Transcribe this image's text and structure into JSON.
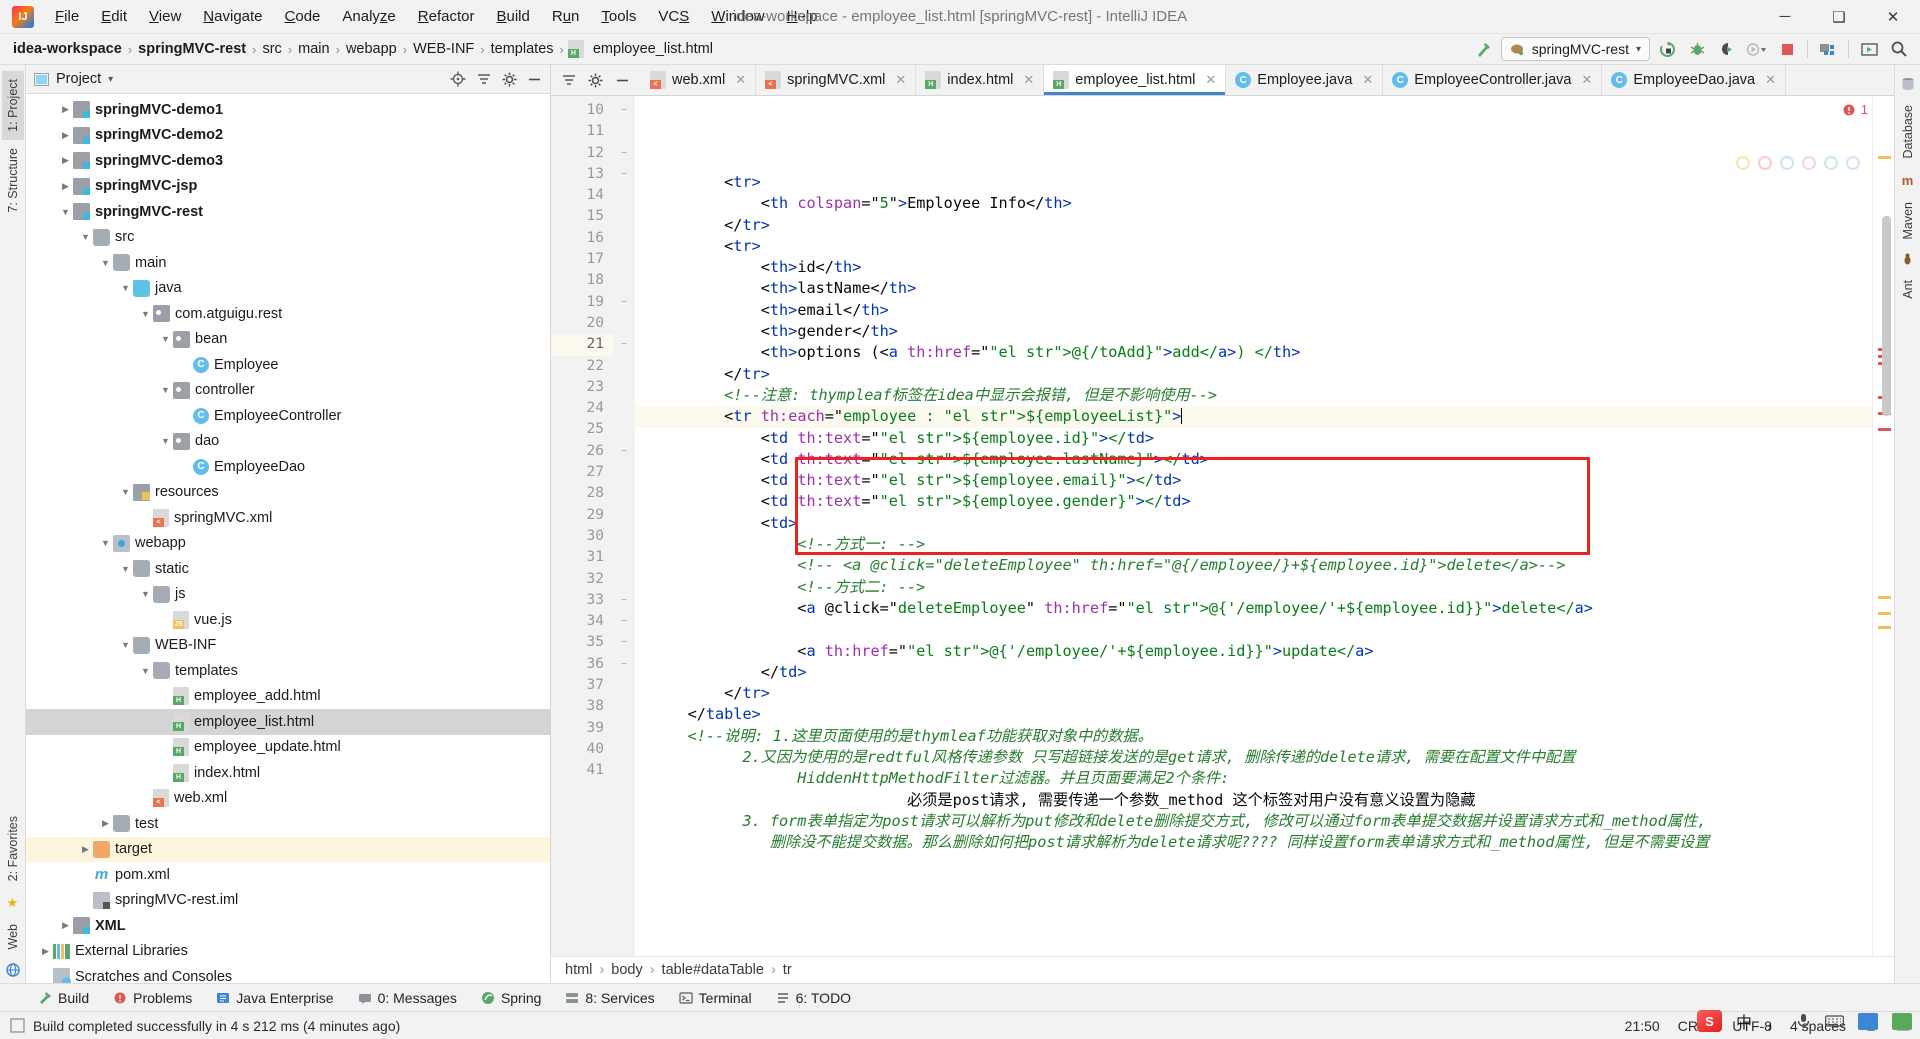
{
  "window": {
    "title": "idea-workspace - employee_list.html [springMVC-rest] - IntelliJ IDEA",
    "logo_text": "IJ",
    "minimize": "─",
    "maximize": "❑",
    "close": "✕"
  },
  "menubar": [
    {
      "label": "File"
    },
    {
      "label": "Edit"
    },
    {
      "label": "View"
    },
    {
      "label": "Navigate"
    },
    {
      "label": "Code"
    },
    {
      "label": "Analyze"
    },
    {
      "label": "Refactor"
    },
    {
      "label": "Build"
    },
    {
      "label": "Run"
    },
    {
      "label": "Tools"
    },
    {
      "label": "VCS"
    },
    {
      "label": "Window"
    },
    {
      "label": "Help"
    }
  ],
  "breadcrumb": {
    "items": [
      {
        "label": "idea-workspace",
        "bold": true
      },
      {
        "label": "springMVC-rest",
        "bold": true
      },
      {
        "label": "src",
        "bold": false
      },
      {
        "label": "main",
        "bold": false
      },
      {
        "label": "webapp",
        "bold": false
      },
      {
        "label": "WEB-INF",
        "bold": false
      },
      {
        "label": "templates",
        "bold": false
      },
      {
        "label": "employee_list.html",
        "bold": false
      }
    ],
    "separator": "›"
  },
  "toolbar": {
    "hammer_icon": "build-hammer-icon",
    "run_config": "springMVC-rest",
    "dropdown_caret": "▾",
    "icons": [
      {
        "name": "run-button"
      },
      {
        "name": "debug-button"
      },
      {
        "name": "run-with-coverage-button"
      },
      {
        "name": "profile-button"
      },
      {
        "name": "stop-button"
      },
      {
        "name": "project-structure-button"
      },
      {
        "name": "updates-button"
      },
      {
        "name": "search-everywhere-button"
      }
    ]
  },
  "left_strip": [
    {
      "label": "1: Project",
      "selected": true
    },
    {
      "label": "7: Structure",
      "selected": false
    },
    {
      "label": "2: Favorites",
      "selected": false
    },
    {
      "label": "Web",
      "selected": false
    }
  ],
  "right_strip": [
    {
      "label": "Database"
    },
    {
      "label": "Maven"
    },
    {
      "label": "Ant"
    }
  ],
  "project_panel": {
    "title": "Project",
    "title_caret": "▾",
    "locate_icon": "locate-icon",
    "collapse_icon": "collapse-all-icon",
    "settings_icon": "gear-icon",
    "hide_icon": "hide-icon",
    "tree": [
      {
        "label": "springMVC-demo1",
        "depth": 1,
        "arrow": "▶",
        "icon": "module",
        "bold": true
      },
      {
        "label": "springMVC-demo2",
        "depth": 1,
        "arrow": "▶",
        "icon": "module",
        "bold": true
      },
      {
        "label": "springMVC-demo3",
        "depth": 1,
        "arrow": "▶",
        "icon": "module",
        "bold": true
      },
      {
        "label": "springMVC-jsp",
        "depth": 1,
        "arrow": "▶",
        "icon": "module",
        "bold": true
      },
      {
        "label": "springMVC-rest",
        "depth": 1,
        "arrow": "▼",
        "icon": "module",
        "bold": true
      },
      {
        "label": "src",
        "depth": 2,
        "arrow": "▼",
        "icon": "folder",
        "bold": false
      },
      {
        "label": "main",
        "depth": 3,
        "arrow": "▼",
        "icon": "folder",
        "bold": false
      },
      {
        "label": "java",
        "depth": 4,
        "arrow": "▼",
        "icon": "folder-src",
        "bold": false
      },
      {
        "label": "com.atguigu.rest",
        "depth": 5,
        "arrow": "▼",
        "icon": "package",
        "bold": false
      },
      {
        "label": "bean",
        "depth": 6,
        "arrow": "▼",
        "icon": "package",
        "bold": false
      },
      {
        "label": "Employee",
        "depth": 7,
        "arrow": "",
        "icon": "class",
        "bold": false
      },
      {
        "label": "controller",
        "depth": 6,
        "arrow": "▼",
        "icon": "package",
        "bold": false
      },
      {
        "label": "EmployeeController",
        "depth": 7,
        "arrow": "",
        "icon": "class",
        "bold": false
      },
      {
        "label": "dao",
        "depth": 6,
        "arrow": "▼",
        "icon": "package",
        "bold": false
      },
      {
        "label": "EmployeeDao",
        "depth": 7,
        "arrow": "",
        "icon": "class",
        "bold": false
      },
      {
        "label": "resources",
        "depth": 4,
        "arrow": "▼",
        "icon": "resources",
        "bold": false
      },
      {
        "label": "springMVC.xml",
        "depth": 5,
        "arrow": "",
        "icon": "file-xml",
        "bold": false
      },
      {
        "label": "webapp",
        "depth": 3,
        "arrow": "▼",
        "icon": "webapp",
        "bold": false
      },
      {
        "label": "static",
        "depth": 4,
        "arrow": "▼",
        "icon": "folder",
        "bold": false
      },
      {
        "label": "js",
        "depth": 5,
        "arrow": "▼",
        "icon": "folder",
        "bold": false
      },
      {
        "label": "vue.js",
        "depth": 6,
        "arrow": "",
        "icon": "file-js",
        "bold": false
      },
      {
        "label": "WEB-INF",
        "depth": 4,
        "arrow": "▼",
        "icon": "folder",
        "bold": false
      },
      {
        "label": "templates",
        "depth": 5,
        "arrow": "▼",
        "icon": "folder",
        "bold": false
      },
      {
        "label": "employee_add.html",
        "depth": 6,
        "arrow": "",
        "icon": "file-html",
        "bold": false
      },
      {
        "label": "employee_list.html",
        "depth": 6,
        "arrow": "",
        "icon": "file-html",
        "bold": false,
        "selected": true
      },
      {
        "label": "employee_update.html",
        "depth": 6,
        "arrow": "",
        "icon": "file-html",
        "bold": false
      },
      {
        "label": "index.html",
        "depth": 6,
        "arrow": "",
        "icon": "file-html",
        "bold": false
      },
      {
        "label": "web.xml",
        "depth": 5,
        "arrow": "",
        "icon": "file-xml",
        "bold": false
      },
      {
        "label": "test",
        "depth": 3,
        "arrow": "▶",
        "icon": "folder",
        "bold": false
      },
      {
        "label": "target",
        "depth": 2,
        "arrow": "▶",
        "icon": "folder-orange",
        "bold": false,
        "highlight": true
      },
      {
        "label": "pom.xml",
        "depth": 2,
        "arrow": "",
        "icon": "maven",
        "bold": false
      },
      {
        "label": "springMVC-rest.iml",
        "depth": 2,
        "arrow": "",
        "icon": "iml",
        "bold": false
      },
      {
        "label": "XML",
        "depth": 1,
        "arrow": "▶",
        "icon": "module",
        "bold": true
      },
      {
        "label": "External Libraries",
        "depth": 0,
        "arrow": "▶",
        "icon": "library",
        "bold": false
      },
      {
        "label": "Scratches and Consoles",
        "depth": 0,
        "arrow": "",
        "icon": "scratches",
        "bold": false
      }
    ]
  },
  "editor_tabs": [
    {
      "label": "web.xml",
      "icon": "file-xml",
      "active": false,
      "close": "✕"
    },
    {
      "label": "springMVC.xml",
      "icon": "file-xml-ok",
      "active": false,
      "close": "✕"
    },
    {
      "label": "index.html",
      "icon": "file-html",
      "active": false,
      "close": "✕"
    },
    {
      "label": "employee_list.html",
      "icon": "file-html",
      "active": true,
      "close": "✕"
    },
    {
      "label": "Employee.java",
      "icon": "class",
      "active": false,
      "close": "✕"
    },
    {
      "label": "EmployeeController.java",
      "icon": "class",
      "active": false,
      "close": "✕"
    },
    {
      "label": "EmployeeDao.java",
      "icon": "class",
      "active": false,
      "close": "✕"
    }
  ],
  "code": {
    "first_line_number": 10,
    "lines": [
      {
        "n": 10,
        "fold": "−",
        "current": false
      },
      {
        "n": 11,
        "fold": "",
        "current": false
      },
      {
        "n": 12,
        "fold": "−",
        "current": false
      },
      {
        "n": 13,
        "fold": "−",
        "current": false
      },
      {
        "n": 14,
        "fold": "",
        "current": false
      },
      {
        "n": 15,
        "fold": "",
        "current": false
      },
      {
        "n": 16,
        "fold": "",
        "current": false
      },
      {
        "n": 17,
        "fold": "",
        "current": false
      },
      {
        "n": 18,
        "fold": "",
        "current": false
      },
      {
        "n": 19,
        "fold": "−",
        "current": false
      },
      {
        "n": 20,
        "fold": "",
        "current": false
      },
      {
        "n": 21,
        "fold": "−",
        "current": true
      },
      {
        "n": 22,
        "fold": "",
        "current": false
      },
      {
        "n": 23,
        "fold": "",
        "current": false
      },
      {
        "n": 24,
        "fold": "",
        "current": false
      },
      {
        "n": 25,
        "fold": "",
        "current": false
      },
      {
        "n": 26,
        "fold": "−",
        "current": false
      },
      {
        "n": 27,
        "fold": "",
        "current": false
      },
      {
        "n": 28,
        "fold": "",
        "current": false
      },
      {
        "n": 29,
        "fold": "",
        "current": false
      },
      {
        "n": 30,
        "fold": "",
        "current": false
      },
      {
        "n": 31,
        "fold": "",
        "current": false
      },
      {
        "n": 32,
        "fold": "",
        "current": false
      },
      {
        "n": 33,
        "fold": "−",
        "current": false
      },
      {
        "n": 34,
        "fold": "−",
        "current": false
      },
      {
        "n": 35,
        "fold": "−",
        "current": false
      },
      {
        "n": 36,
        "fold": "−",
        "current": false
      },
      {
        "n": 37,
        "fold": "",
        "current": false
      },
      {
        "n": 38,
        "fold": "",
        "current": false
      },
      {
        "n": 39,
        "fold": "",
        "current": false
      },
      {
        "n": 40,
        "fold": "",
        "current": false
      },
      {
        "n": 41,
        "fold": "",
        "current": false
      }
    ],
    "text": [
      "        <tr>",
      "            <th colspan=\"5\">Employee Info</th>",
      "        </tr>",
      "        <tr>",
      "            <th>id</th>",
      "            <th>lastName</th>",
      "            <th>email</th>",
      "            <th>gender</th>",
      "            <th>options (<a th:href=\"@{/toAdd}\">add</a>) </th>",
      "        </tr>",
      "        <!--注意: thympleaf标签在idea中显示会报错, 但是不影响使用-->",
      "        <tr th:each=\"employee : ${employeeList}\">",
      "            <td th:text=\"${employee.id}\"></td>",
      "            <td th:text=\"${employee.lastName}\"></td>",
      "            <td th:text=\"${employee.email}\"></td>",
      "            <td th:text=\"${employee.gender}\"></td>",
      "            <td>",
      "                <!--方式一: -->",
      "                <!-- <a @click=\"deleteEmployee\" th:href=\"@{/employee/}+${employee.id}\">delete</a>-->",
      "                <!--方式二: -->",
      "                <a @click=\"deleteEmployee\" th:href=\"@{'/employee/'+${employee.id}}\">delete</a>",
      "",
      "                <a th:href=\"@{'/employee/'+${employee.id}}\">update</a>",
      "            </td>",
      "        </tr>",
      "    </table>",
      "    <!--说明: 1.这里页面使用的是thymleaf功能获取对象中的数据。",
      "          2.又因为使用的是redtful风格传递参数 只写超链接发送的是get请求, 删除传递的delete请求, 需要在配置文件中配置",
      "                HiddenHttpMethodFilter过滤器。并且页面要满足2个条件:",
      "                            必须是post请求, 需要传递一个参数_method 这个标签对用户没有意义设置为隐藏",
      "          3. form表单指定为post请求可以解析为put修改和delete删除提交方式, 修改可以通过form表单提交数据并设置请求方式和_method属性,",
      "             删除没不能提交数据。那么删除如何把post请求解析为delete请求呢???? 同样设置form表单请求方式和_method属性, 但是不需要设置"
    ]
  },
  "editor_breadcrumb": {
    "items": [
      "html",
      "body",
      "table#dataTable",
      "tr"
    ],
    "separator": "›"
  },
  "bottom_bar": [
    {
      "label": "Build",
      "icon": "build-icon",
      "shortcut": ""
    },
    {
      "label": "Problems",
      "icon": "problems-icon",
      "shortcut": ""
    },
    {
      "label": "Java Enterprise",
      "icon": "java-ee-icon",
      "shortcut": ""
    },
    {
      "label": "0: Messages",
      "icon": "messages-icon",
      "shortcut": "0"
    },
    {
      "label": "Spring",
      "icon": "spring-icon",
      "shortcut": ""
    },
    {
      "label": "8: Services",
      "icon": "services-icon",
      "shortcut": "8"
    },
    {
      "label": "Terminal",
      "icon": "terminal-icon",
      "shortcut": ""
    },
    {
      "label": "6: TODO",
      "icon": "todo-icon",
      "shortcut": "6"
    }
  ],
  "status_bar": {
    "message": "Build completed successfully in 4 s 212 ms (4 minutes ago)",
    "time": "21:50",
    "line_separator": "CRLF",
    "encoding": "UTF-8",
    "indent": "4 spaces",
    "lock_icon": "lock-icon",
    "events_icon": "events-icon",
    "ime": {
      "logo": "S",
      "lang": "中",
      "comma": "，",
      "mic_icon": "microphone-icon",
      "keyboard_icon": "keyboard-icon",
      "tools_icon": "toolbox-icon",
      "menu_icon": "menu-icon"
    }
  },
  "colors": {
    "accent": "#3c86d4",
    "highlight_box": "#ef2020",
    "selection": "#c9e6f5",
    "current_line": "#fcfaef",
    "string": "#067d17",
    "tag": "#0033b3",
    "attribute": "#9b2fae",
    "comment_cn": "#267d2e",
    "error": "#e05555",
    "warning": "#f0c060"
  }
}
